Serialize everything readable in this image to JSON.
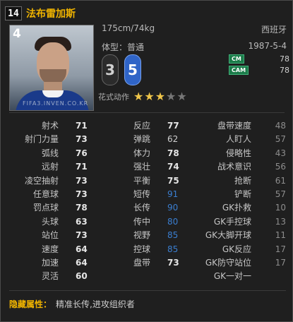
{
  "header": {
    "season_icon": "14",
    "player_name": "法布雷加斯"
  },
  "photo": {
    "overall": "4",
    "watermark": "FIFA3.INVEN.CO.KR"
  },
  "profile": {
    "height_weight": "175cm/74kg",
    "nationality": "西班牙",
    "body_type": "体型：普通",
    "birth_date": "1987-5-4"
  },
  "feet": {
    "left": "3",
    "right": "5"
  },
  "positions": [
    {
      "label": "CM",
      "value": "78"
    },
    {
      "label": "CAM",
      "value": "78"
    }
  ],
  "skill_moves": {
    "label": "花式动作",
    "stars_on": 3,
    "stars_total": 5
  },
  "stats": {
    "col1": [
      {
        "label": "射术",
        "value": "71"
      },
      {
        "label": "射门力量",
        "value": "73"
      },
      {
        "label": "弧线",
        "value": "76"
      },
      {
        "label": "远射",
        "value": "71"
      },
      {
        "label": "凌空抽射",
        "value": "73"
      },
      {
        "label": "任意球",
        "value": "73"
      },
      {
        "label": "罚点球",
        "value": "78"
      },
      {
        "label": "头球",
        "value": "63"
      },
      {
        "label": "站位",
        "value": "73"
      },
      {
        "label": "速度",
        "value": "64"
      },
      {
        "label": "加速",
        "value": "64"
      },
      {
        "label": "灵活",
        "value": "60"
      }
    ],
    "col2": [
      {
        "label": "反应",
        "value": "77",
        "style": "white"
      },
      {
        "label": "弹跳",
        "value": "62",
        "style": "normal"
      },
      {
        "label": "体力",
        "value": "78",
        "style": "white"
      },
      {
        "label": "强壮",
        "value": "74",
        "style": "white"
      },
      {
        "label": "平衡",
        "value": "75",
        "style": "white"
      },
      {
        "label": "短传",
        "value": "91",
        "style": "blue"
      },
      {
        "label": "长传",
        "value": "90",
        "style": "blue"
      },
      {
        "label": "传中",
        "value": "80",
        "style": "blue"
      },
      {
        "label": "视野",
        "value": "85",
        "style": "blue"
      },
      {
        "label": "控球",
        "value": "85",
        "style": "blue"
      },
      {
        "label": "盘带",
        "value": "73",
        "style": "white"
      }
    ],
    "col3": [
      {
        "label": "盘带速度",
        "value": "48"
      },
      {
        "label": "人盯人",
        "value": "57"
      },
      {
        "label": "侵略性",
        "value": "43"
      },
      {
        "label": "战术意识",
        "value": "56"
      },
      {
        "label": "抢断",
        "value": "61"
      },
      {
        "label": "铲断",
        "value": "57"
      },
      {
        "label": "GK扑救",
        "value": "10"
      },
      {
        "label": "GK手控球",
        "value": "13"
      },
      {
        "label": "GK大脚开球",
        "value": "11"
      },
      {
        "label": "GK反应",
        "value": "17"
      },
      {
        "label": "GK防守站位",
        "value": "17"
      },
      {
        "label": "GK一对一",
        "value": ""
      }
    ]
  },
  "hidden_attributes": {
    "label": "隐藏属性：",
    "value": "精准长传,进攻组织者"
  },
  "colors": {
    "name_gold": "#f0b400",
    "stat_blue": "#3a7ed0",
    "foot_blue": "#2f64c7",
    "pos_green": "#1c7c4a"
  }
}
